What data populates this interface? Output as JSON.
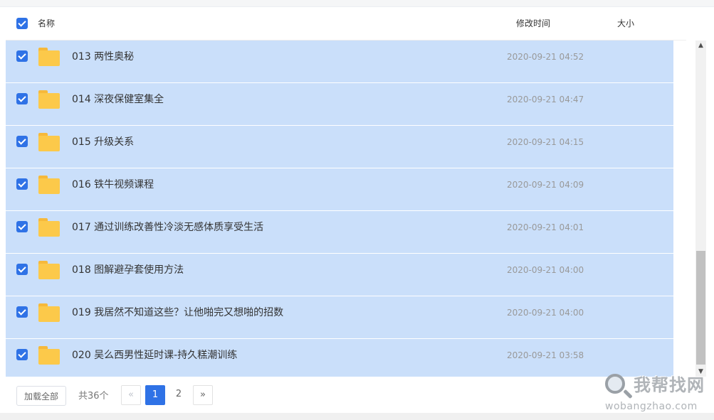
{
  "header": {
    "col_name": "名称",
    "col_time": "修改时间",
    "col_size": "大小"
  },
  "files": [
    {
      "name": "013 两性奥秘",
      "time": "2020-09-21 04:52",
      "icon": "folder-icon"
    },
    {
      "name": "014 深夜保健室集全",
      "time": "2020-09-21 04:47",
      "icon": "folder-icon"
    },
    {
      "name": "015 升级关系",
      "time": "2020-09-21 04:15",
      "icon": "folder-icon"
    },
    {
      "name": "016 铁牛视频课程",
      "time": "2020-09-21 04:09",
      "icon": "folder-icon"
    },
    {
      "name": "017 通过训练改善性冷淡无感体质享受生活",
      "time": "2020-09-21 04:01",
      "icon": "folder-icon"
    },
    {
      "name": "018 图解避孕套使用方法",
      "time": "2020-09-21 04:00",
      "icon": "folder-icon"
    },
    {
      "name": "019 我居然不知道这些？让他啪完又想啪的招数",
      "time": "2020-09-21 04:00",
      "icon": "folder-icon"
    },
    {
      "name": "020 吴么西男性延时课-持久糕潮训练",
      "time": "2020-09-21 03:58",
      "icon": "folder-icon"
    }
  ],
  "pager": {
    "load_all": "加载全部",
    "total": "共36个",
    "prev": "«",
    "page1": "1",
    "page2": "2",
    "next": "»"
  },
  "watermark": {
    "cn": "我帮找网",
    "en": "wobangzhao.com"
  },
  "colors": {
    "selected_row": "#cadffa",
    "accent": "#2f72e6",
    "folder": "#fcc94a"
  }
}
